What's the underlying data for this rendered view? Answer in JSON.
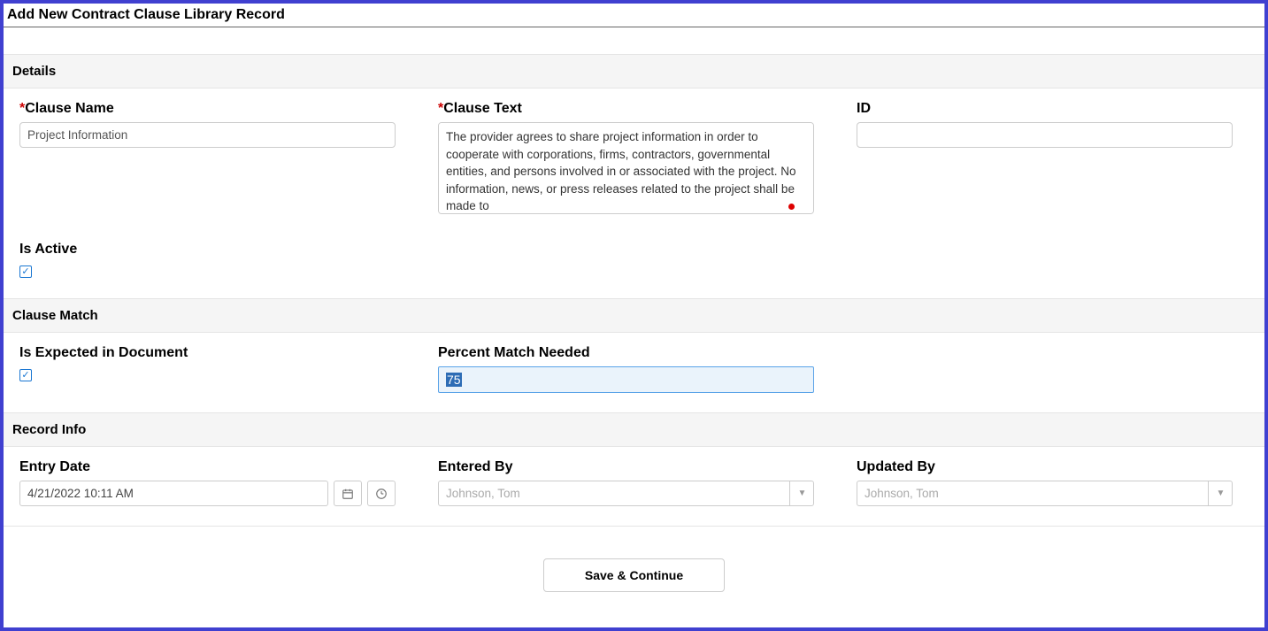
{
  "page_title": "Add New Contract Clause Library Record",
  "sections": {
    "details": {
      "title": "Details",
      "clause_name": {
        "label": "Clause Name",
        "value": "Project Information",
        "required": true
      },
      "clause_text": {
        "label": "Clause Text",
        "value": "The provider agrees to share project information in order to cooperate with corporations, firms, contractors, governmental entities, and persons involved in or associated with the project. No information, news, or press releases related to the project shall be made to",
        "required": true
      },
      "id": {
        "label": "ID",
        "value": ""
      },
      "is_active": {
        "label": "Is Active",
        "checked": true
      }
    },
    "clause_match": {
      "title": "Clause Match",
      "is_expected": {
        "label": "Is Expected in Document",
        "checked": true
      },
      "percent_match": {
        "label": "Percent Match Needed",
        "value": "75"
      }
    },
    "record_info": {
      "title": "Record Info",
      "entry_date": {
        "label": "Entry Date",
        "value": "4/21/2022 10:11 AM"
      },
      "entered_by": {
        "label": "Entered By",
        "value": "Johnson, Tom"
      },
      "updated_by": {
        "label": "Updated By",
        "value": "Johnson, Tom"
      }
    }
  },
  "footer": {
    "save_continue": "Save & Continue"
  },
  "glyphs": {
    "check": "✓",
    "down": "▼"
  }
}
